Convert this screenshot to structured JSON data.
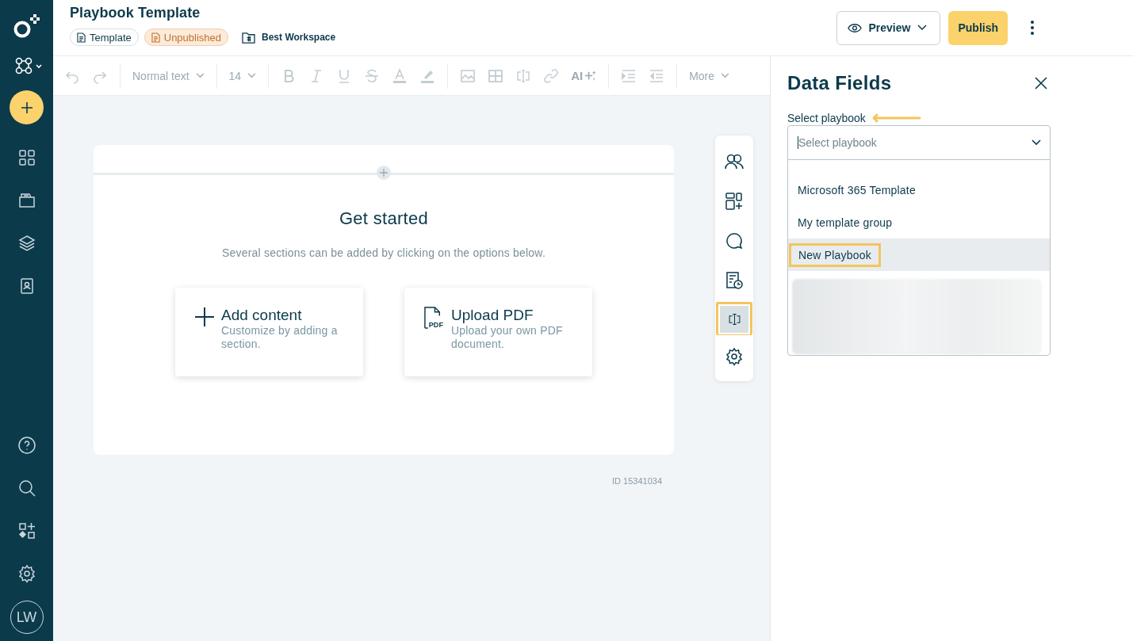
{
  "nav": {
    "top": [
      {
        "kind": "logo"
      },
      {
        "kind": "network"
      }
    ],
    "add": {
      "kind": "add"
    },
    "items": [
      {
        "kind": "grid"
      },
      {
        "kind": "folder"
      },
      {
        "kind": "layers"
      },
      {
        "kind": "contact"
      }
    ],
    "bottom": [
      {
        "kind": "help"
      },
      {
        "kind": "search"
      },
      {
        "kind": "apps"
      },
      {
        "kind": "settings"
      }
    ],
    "user": {
      "initials": "LW"
    }
  },
  "header": {
    "title": "Playbook Template",
    "badges": [
      {
        "label": "Template",
        "kind": "type"
      },
      {
        "label": "Unpublished",
        "kind": "status"
      }
    ],
    "workspace": "Best Workspace",
    "preview": "Preview",
    "publish": "Publish"
  },
  "toolbar": {
    "disabled": true,
    "style": "Normal text",
    "size": "14",
    "ai": "AI",
    "more": "More"
  },
  "canvas": {
    "title": "Get started",
    "subtitle": "Several sections can be added by clicking on the options below.",
    "cards": [
      {
        "kind": "add",
        "title": "Add content",
        "description": "Customize by adding a section."
      },
      {
        "kind": "pdf",
        "icon_text": "PDF",
        "title": "Upload PDF",
        "description": "Upload your own PDF document."
      }
    ],
    "id": "ID 15341034"
  },
  "side_tools": [
    {
      "kind": "people",
      "selected": false,
      "highlighted": false
    },
    {
      "kind": "blocks",
      "selected": false,
      "highlighted": false
    },
    {
      "kind": "comment",
      "selected": false,
      "highlighted": false
    },
    {
      "kind": "history",
      "selected": false,
      "highlighted": false
    },
    {
      "kind": "field",
      "selected": true,
      "highlighted": true
    },
    {
      "kind": "settings",
      "selected": false,
      "highlighted": false
    }
  ],
  "panel": {
    "title": "Data Fields",
    "label": "Select playbook",
    "placeholder": "Select playbook",
    "options": [
      {
        "label": "Microsoft 365 Template",
        "selected": false,
        "highlighted": false
      },
      {
        "label": "My template group",
        "selected": false,
        "highlighted": false
      },
      {
        "label": "New Playbook",
        "selected": true,
        "highlighted": true
      }
    ],
    "redacted": true
  }
}
